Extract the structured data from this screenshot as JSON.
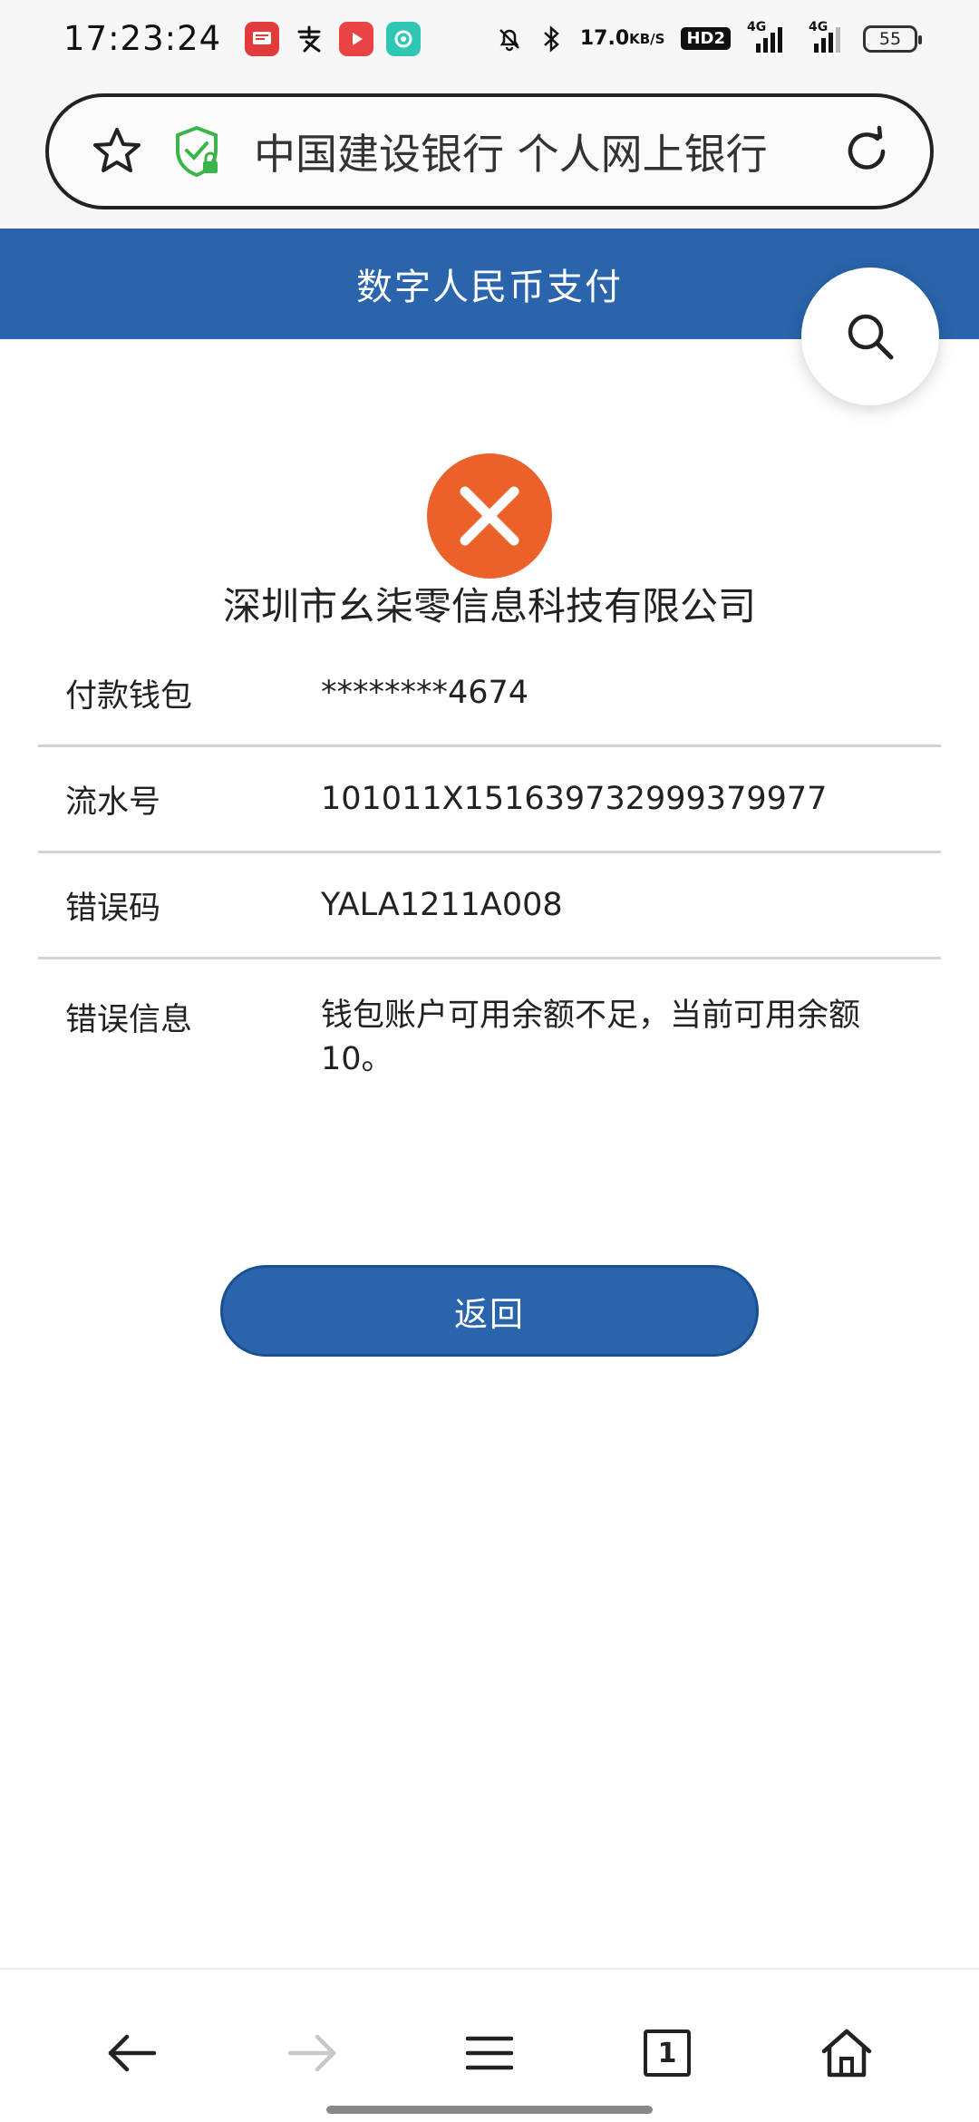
{
  "status_bar": {
    "time": "17:23:24",
    "net_speed_value": "17.0",
    "net_speed_unit": "KB/S",
    "hd_badge": "HD2",
    "signal_1": "4G",
    "signal_2": "4G",
    "battery": "55",
    "app_icons": [
      {
        "name": "news-app-icon",
        "color": "#e23b3b"
      },
      {
        "name": "alipay-app-icon",
        "color": "#111111"
      },
      {
        "name": "video-app-icon",
        "color": "#e94444"
      },
      {
        "name": "chat-app-icon",
        "color": "#2fc6b5"
      }
    ]
  },
  "browser": {
    "url_title": "中国建设银行 个人网上银行"
  },
  "header": {
    "title": "数字人民币支付"
  },
  "result": {
    "merchant_name": "深圳市幺柒零信息科技有限公司",
    "details": [
      {
        "label": "付款钱包",
        "value": "********4674"
      },
      {
        "label": "流水号",
        "value": "101011X151639732999379977"
      },
      {
        "label": "错误码",
        "value": "YALA1211A008"
      },
      {
        "label": "错误信息",
        "value": "钱包账户可用余额不足，当前可用余额10。"
      }
    ]
  },
  "actions": {
    "return_label": "返回"
  },
  "bottom_nav": {
    "tab_count": "1"
  },
  "colors": {
    "brand_blue": "#2a64ad",
    "error_orange": "#ec6129"
  }
}
